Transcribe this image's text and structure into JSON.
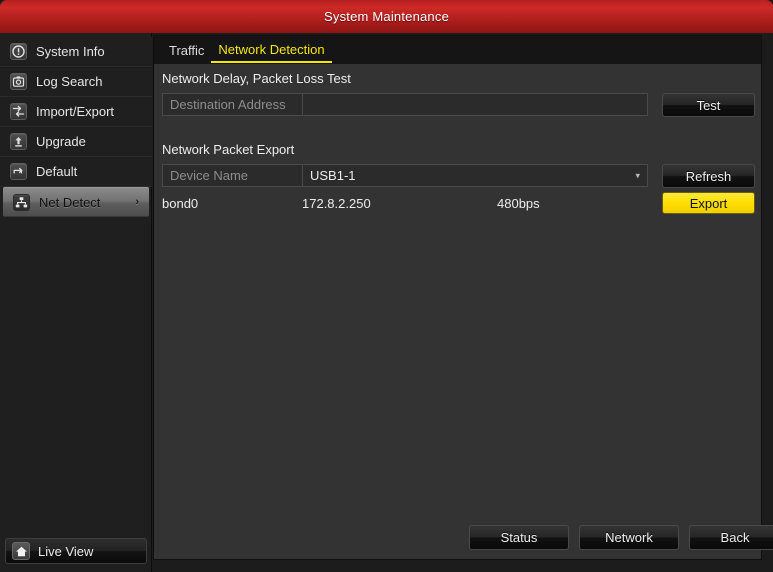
{
  "window": {
    "title": "System Maintenance"
  },
  "sidebar": {
    "items": [
      {
        "label": "System Info",
        "icon": "info-icon",
        "active": false
      },
      {
        "label": "Log Search",
        "icon": "log-search-icon",
        "active": false
      },
      {
        "label": "Import/Export",
        "icon": "import-export-icon",
        "active": false
      },
      {
        "label": "Upgrade",
        "icon": "upgrade-icon",
        "active": false
      },
      {
        "label": "Default",
        "icon": "default-icon",
        "active": false
      },
      {
        "label": "Net Detect",
        "icon": "net-detect-icon",
        "active": true,
        "chevron": "›"
      }
    ],
    "live_view": {
      "label": "Live View",
      "icon": "home-icon"
    }
  },
  "main": {
    "tabs": [
      {
        "label": "Traffic",
        "active": false
      },
      {
        "label": "Network Detection",
        "active": true
      }
    ],
    "section_delay": {
      "title": "Network Delay, Packet Loss Test",
      "destination": {
        "label": "Destination Address",
        "value": "",
        "placeholder": ""
      },
      "test_button": "Test"
    },
    "section_export": {
      "title": "Network Packet Export",
      "device": {
        "label": "Device Name",
        "selected": "USB1-1",
        "options": [
          "USB1-1"
        ],
        "caret": "▾"
      },
      "refresh_button": "Refresh",
      "export_button": "Export",
      "row": {
        "name": "bond0",
        "address": "172.8.2.250",
        "rate": "480bps"
      }
    },
    "footer": {
      "status_button": "Status",
      "network_button": "Network",
      "back_button": "Back"
    }
  },
  "colors": {
    "title_red": "#cf2a27",
    "accent_yellow": "#f5e800",
    "export_yellow": "#ffdf00",
    "panel_bg": "#333333",
    "sidebar_bg": "#1f1f1f"
  }
}
